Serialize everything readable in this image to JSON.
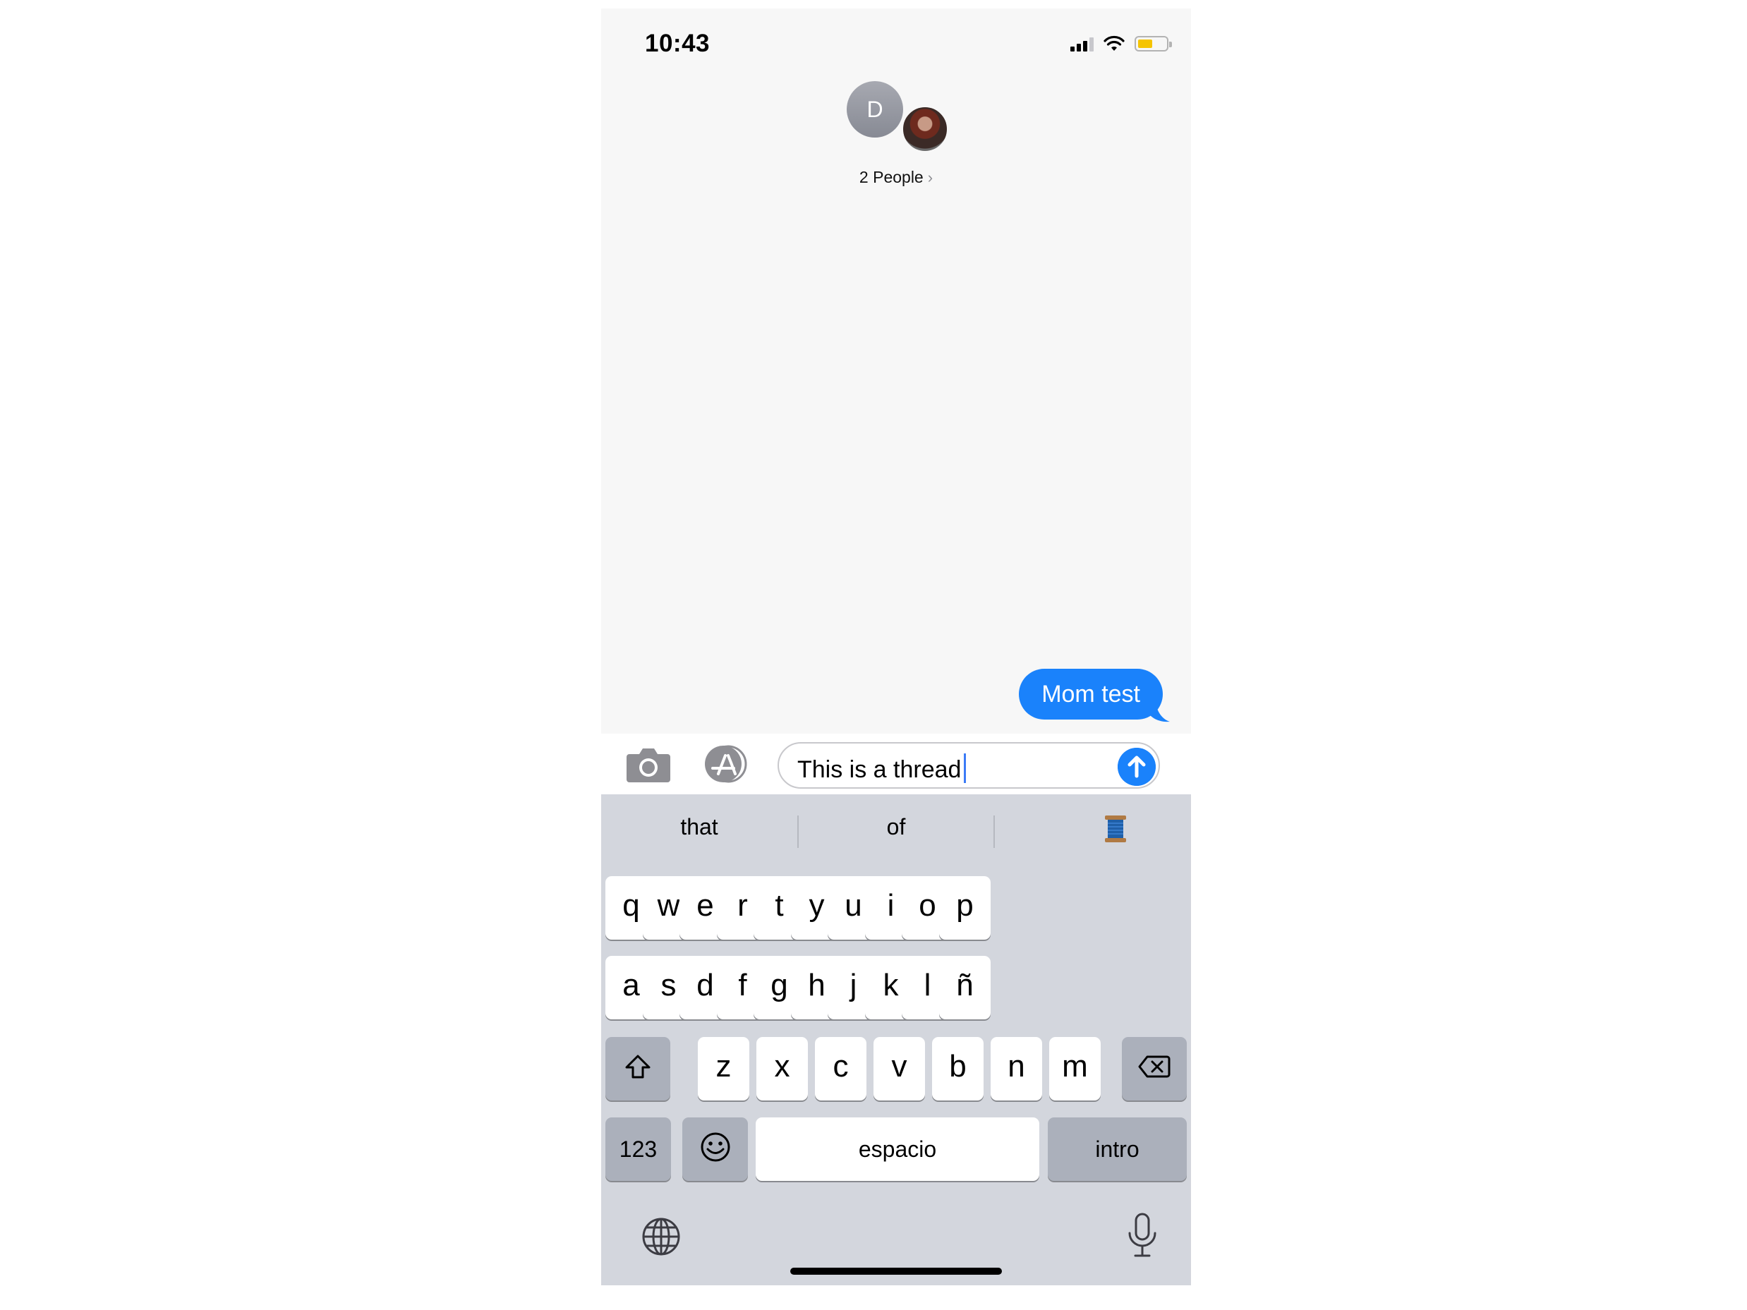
{
  "status_bar": {
    "time": "10:43",
    "battery_color": "#f5c400"
  },
  "conversation": {
    "avatar_initial": "D",
    "people_label": "2 People",
    "chevron": "›"
  },
  "messages": [
    {
      "text": "Mom test",
      "direction": "outgoing",
      "color": "#1a82fb"
    }
  ],
  "composer": {
    "text": "This is a thread",
    "camera_icon": "camera-icon",
    "appstore_icon": "app-store-icon",
    "send_icon": "send-arrow-icon"
  },
  "keyboard": {
    "suggestions": [
      "that",
      "of",
      "🧵"
    ],
    "row1": [
      "q",
      "w",
      "e",
      "r",
      "t",
      "y",
      "u",
      "i",
      "o",
      "p"
    ],
    "row2": [
      "a",
      "s",
      "d",
      "f",
      "g",
      "h",
      "j",
      "k",
      "l",
      "ñ"
    ],
    "row3": [
      "z",
      "x",
      "c",
      "v",
      "b",
      "n",
      "m"
    ],
    "numbers_label": "123",
    "space_label": "espacio",
    "return_label": "intro"
  },
  "colors": {
    "accent": "#1a82fb",
    "keyboard_bg": "#d3d6dd",
    "special_key": "#abb0bb"
  }
}
